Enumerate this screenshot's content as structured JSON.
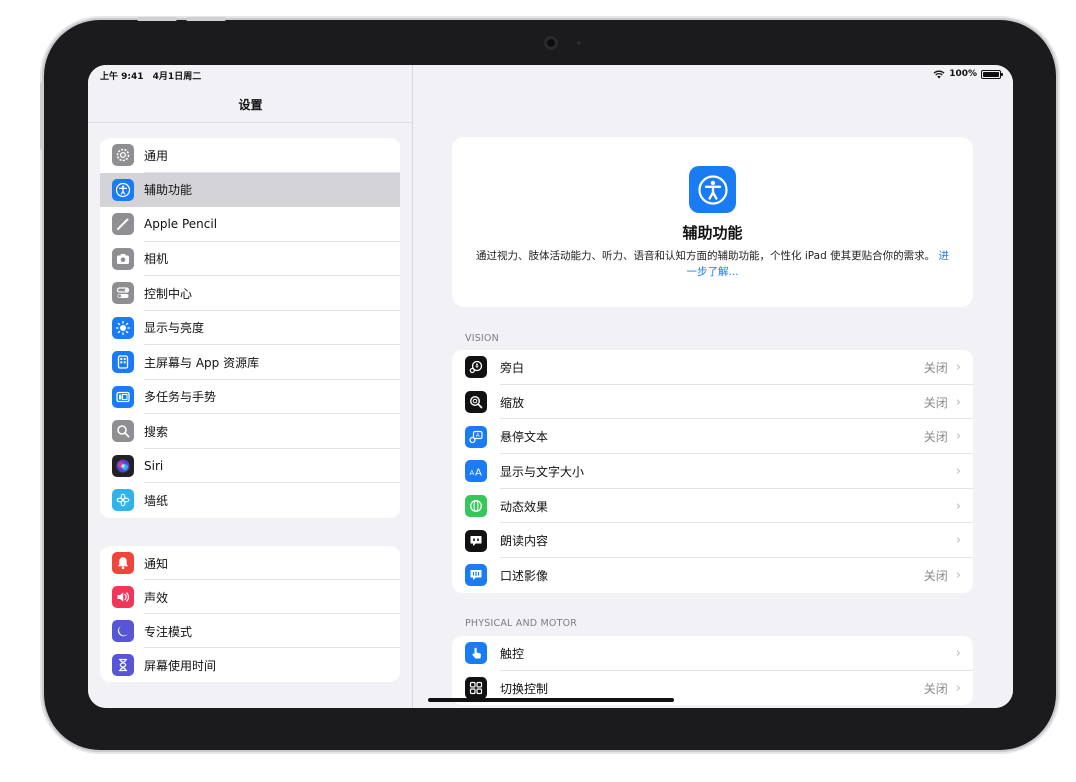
{
  "status": {
    "time": "上午 9:41",
    "date": "4月1日周二",
    "battery": "100%"
  },
  "sidebar": {
    "title": "设置",
    "group1": [
      {
        "label": "通用",
        "icon": "gear-icon",
        "color": "#8e8e93"
      },
      {
        "label": "辅助功能",
        "icon": "accessibility-icon",
        "color": "#1a7cf4",
        "selected": true
      },
      {
        "label": "Apple Pencil",
        "icon": "pencil-icon",
        "color": "#8e8e93"
      },
      {
        "label": "相机",
        "icon": "camera-icon",
        "color": "#8e8e93"
      },
      {
        "label": "控制中心",
        "icon": "toggles-icon",
        "color": "#8e8e93"
      },
      {
        "label": "显示与亮度",
        "icon": "sun-icon",
        "color": "#1a7cf4"
      },
      {
        "label": "主屏幕与 App 资源库",
        "icon": "home-screen-icon",
        "color": "#1a7cf4"
      },
      {
        "label": "多任务与手势",
        "icon": "multitask-icon",
        "color": "#1a7cf4"
      },
      {
        "label": "搜索",
        "icon": "search-icon",
        "color": "#8e8e93"
      },
      {
        "label": "Siri",
        "icon": "siri-icon",
        "color": "#222222"
      },
      {
        "label": "墙纸",
        "icon": "flower-icon",
        "color": "#2fb3e8"
      }
    ],
    "group2": [
      {
        "label": "通知",
        "icon": "bell-icon",
        "color": "#f0453a"
      },
      {
        "label": "声效",
        "icon": "speaker-icon",
        "color": "#f2365a"
      },
      {
        "label": "专注模式",
        "icon": "moon-icon",
        "color": "#5856d6"
      },
      {
        "label": "屏幕使用时间",
        "icon": "hourglass-icon",
        "color": "#5856d6"
      }
    ]
  },
  "main": {
    "hero": {
      "title": "辅助功能",
      "description": "通过视力、肢体活动能力、听力、语音和认知方面的辅助功能，个性化 iPad 使其更贴合你的需求。",
      "link": "进一步了解..."
    },
    "vision": {
      "label": "VISION",
      "items": [
        {
          "label": "旁白",
          "value": "关闭",
          "icon": "voiceover-icon",
          "color": "#111111"
        },
        {
          "label": "缩放",
          "value": "关闭",
          "icon": "zoom-icon",
          "color": "#111111"
        },
        {
          "label": "悬停文本",
          "value": "关闭",
          "icon": "hover-text-icon",
          "color": "#1a7cf4"
        },
        {
          "label": "显示与文字大小",
          "value": "",
          "icon": "text-size-icon",
          "color": "#1a7cf4"
        },
        {
          "label": "动态效果",
          "value": "",
          "icon": "motion-icon",
          "color": "#34c759"
        },
        {
          "label": "朗读内容",
          "value": "",
          "icon": "spoken-content-icon",
          "color": "#111111"
        },
        {
          "label": "口述影像",
          "value": "关闭",
          "icon": "audio-description-icon",
          "color": "#1a7cf4"
        }
      ]
    },
    "physical": {
      "label": "PHYSICAL AND MOTOR",
      "items": [
        {
          "label": "触控",
          "value": "",
          "icon": "touch-icon",
          "color": "#1a7cf4"
        },
        {
          "label": "切换控制",
          "value": "关闭",
          "icon": "switch-control-icon",
          "color": "#111111"
        }
      ]
    }
  }
}
